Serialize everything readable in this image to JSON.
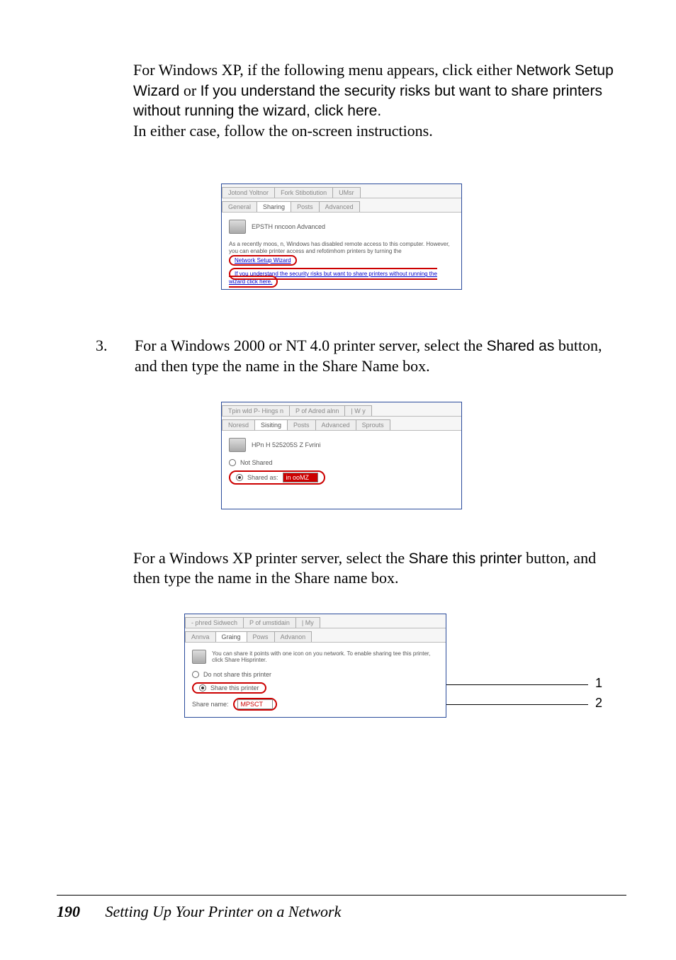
{
  "para1_a": "For Windows XP, if the following menu appears, click either ",
  "para1_b": "Network Setup Wizard",
  "para1_c": " or ",
  "para1_d": "If you understand the security risks but want to share printers without running the wizard, click here.",
  "para1_e": "In either case, follow the on-screen instructions.",
  "dlg1": {
    "tabs": [
      "Jotond Yoltnor",
      "Fork Stibotiution",
      "UMsr",
      "General",
      "Sharing",
      "Posts",
      "Advanced"
    ],
    "printer": "EPSTH nncoon Advanced",
    "body_text": "As a recently moos, n, Windows has disabled remote access to this computer. However, you can enable printer access and refotimhom printers by turning the",
    "link1": "Network Setup Wizard",
    "link2": "If you understand the security risks but want to share printers without running the wizard click here."
  },
  "step3_num": "3.",
  "step3_a": "For a Windows 2000 or NT 4.0 printer server, select the ",
  "step3_b": "Shared as",
  "step3_c": " button, and then type the name in the Share Name box.",
  "dlg2": {
    "tabs": [
      "Tpin wld P- Hings n",
      "P of Adred alnn",
      "| W y",
      "Noresd",
      "Sisiting",
      "Posts",
      "Advanced",
      "Sprouts"
    ],
    "printer": "HPn H 525205S Z Fvrini",
    "radio_notshared": "Not Shared",
    "radio_sharedas": "Shared as:",
    "value": "in ooMZ"
  },
  "para3_a": "For a Windows XP printer server, select the ",
  "para3_b": "Share this printer",
  "para3_c": " button, and then type the name in the Share name box.",
  "dlg3": {
    "tabs": [
      "- phred Sidwech",
      "P of umstidain",
      "| My",
      "Annva",
      "Graing",
      "Pows",
      "Advanon"
    ],
    "body_text": "You can share it points with one icon on you network. To enable sharing tee this printer, click Share Hisprinter.",
    "radio_donot": "Do not share this printer",
    "radio_share": "Share this printer",
    "share_label": "Share name:",
    "share_value": "MPSCT"
  },
  "callout1": "1",
  "callout2": "2",
  "footer_page": "190",
  "footer_text": "Setting Up Your Printer on a Network"
}
